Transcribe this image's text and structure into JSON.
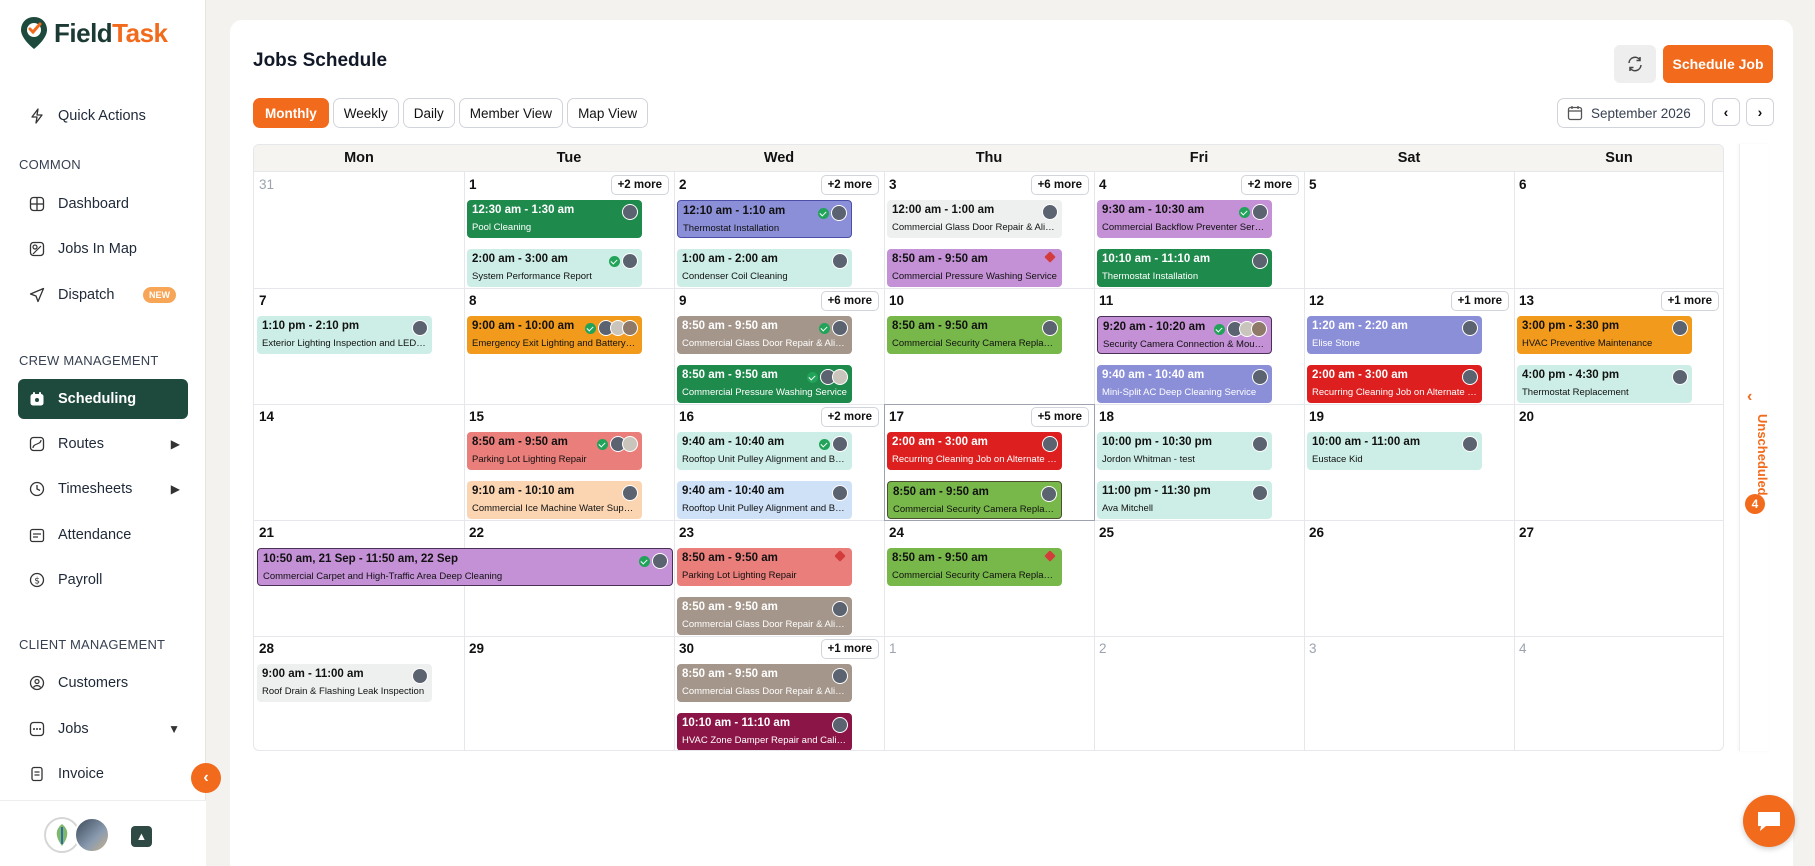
{
  "app": {
    "name_main": "Field",
    "name_accent": "Task"
  },
  "sidebar": {
    "quick_actions": "Quick Actions",
    "common_label": "COMMON",
    "common": [
      {
        "label": "Dashboard",
        "icon": "grid-icon"
      },
      {
        "label": "Jobs In Map",
        "icon": "map-icon"
      },
      {
        "label": "Dispatch",
        "icon": "send-icon",
        "badge": "NEW"
      }
    ],
    "crew_label": "CREW MANAGEMENT",
    "crew": [
      {
        "label": "Scheduling",
        "icon": "calendar-icon",
        "active": true
      },
      {
        "label": "Routes",
        "icon": "route-icon"
      },
      {
        "label": "Timesheets",
        "icon": "clock-icon"
      },
      {
        "label": "Attendance",
        "icon": "attendance-icon"
      },
      {
        "label": "Payroll",
        "icon": "payroll-icon"
      }
    ],
    "client_label": "CLIENT MANAGEMENT",
    "client": [
      {
        "label": "Customers",
        "icon": "customers-icon"
      },
      {
        "label": "Jobs",
        "icon": "jobs-icon"
      },
      {
        "label": "Invoice",
        "icon": "invoice-icon"
      }
    ]
  },
  "header": {
    "title": "Jobs Schedule",
    "schedule_button": "Schedule Job",
    "month": "September 2026"
  },
  "views": [
    "Monthly",
    "Weekly",
    "Daily",
    "Member View",
    "Map View"
  ],
  "active_view": "Monthly",
  "days": [
    "Mon",
    "Tue",
    "Wed",
    "Thu",
    "Fri",
    "Sat",
    "Sun"
  ],
  "weeks": [
    [
      {
        "num": "31",
        "muted": true
      },
      {
        "num": "1",
        "more": "+2 more",
        "events": [
          {
            "time": "12:30 am - 1:30 am",
            "title": "Pool Cleaning",
            "color": "green",
            "check": false,
            "avatars": 1
          },
          {
            "time": "2:00 am - 3:00 am",
            "title": "System Performance Report",
            "color": "mint",
            "check": true,
            "avatars": 1
          }
        ]
      },
      {
        "num": "2",
        "more": "+2 more",
        "events": [
          {
            "time": "12:10 am - 1:10 am",
            "title": "Thermostat Installation",
            "color": "blue",
            "check": true,
            "avatars": 1
          },
          {
            "time": "1:00 am - 2:00 am",
            "title": "Condenser Coil Cleaning",
            "color": "mint",
            "check": false,
            "avatars": 1
          }
        ]
      },
      {
        "num": "3",
        "more": "+6 more",
        "events": [
          {
            "time": "12:00 am - 1:00 am",
            "title": "Commercial Glass Door Repair & Alignment",
            "color": "gray",
            "check": false,
            "avatars": 1
          },
          {
            "time": "8:50 am - 9:50 am",
            "title": "Commercial Pressure Washing Service",
            "color": "purple",
            "check": false,
            "pin": true,
            "avatars": 0
          }
        ]
      },
      {
        "num": "4",
        "more": "+2 more",
        "events": [
          {
            "time": "9:30 am - 10:30 am",
            "title": "Commercial Backflow Preventer Service",
            "color": "purple",
            "check": true,
            "avatars": 1
          },
          {
            "time": "10:10 am - 11:10 am",
            "title": "Thermostat Installation",
            "color": "green",
            "check": false,
            "avatars": 1
          }
        ]
      },
      {
        "num": "5"
      },
      {
        "num": "6"
      }
    ],
    [
      {
        "num": "7",
        "events": [
          {
            "time": "1:10 pm - 2:10 pm",
            "title": "Exterior Lighting Inspection and LED Fixture Upgrade",
            "color": "mint",
            "check": false,
            "avatars": 1
          }
        ]
      },
      {
        "num": "8",
        "events": [
          {
            "time": "9:00 am - 10:00 am",
            "title": "Emergency Exit Lighting and Battery Backup Test",
            "color": "orange",
            "check": true,
            "avatars": 3
          }
        ]
      },
      {
        "num": "9",
        "more": "+6 more",
        "events": [
          {
            "time": "8:50 am - 9:50 am",
            "title": "Commercial Glass Door Repair & Alignment",
            "color": "taupe",
            "check": true,
            "avatars": 1
          },
          {
            "time": "8:50 am - 9:50 am",
            "title": "Commercial Pressure Washing Service",
            "color": "green",
            "check": true,
            "avatars": 2
          }
        ]
      },
      {
        "num": "10",
        "events": [
          {
            "time": "8:50 am - 9:50 am",
            "title": "Commercial Security Camera Replacement",
            "color": "lgreen",
            "check": false,
            "avatars": 1
          }
        ]
      },
      {
        "num": "11",
        "events": [
          {
            "time": "9:20 am - 10:20 am",
            "title": "Security Camera Connection & Mounting Fix",
            "color": "purple-b",
            "check": true,
            "avatars": 3
          },
          {
            "time": "9:40 am - 10:40 am",
            "title": "Mini-Split AC Deep Cleaning Service",
            "color": "periw",
            "check": false,
            "avatars": 1
          }
        ]
      },
      {
        "num": "12",
        "more": "+1 more",
        "events": [
          {
            "time": "1:20 am - 2:20 am",
            "title": "Elise Stone",
            "color": "periw",
            "check": false,
            "avatars": 1
          },
          {
            "time": "2:00 am - 3:00 am",
            "title": "Recurring Cleaning Job on Alternate Fridays",
            "color": "red",
            "check": false,
            "avatars": 1
          }
        ]
      },
      {
        "num": "13",
        "more": "+1 more",
        "events": [
          {
            "time": "3:00 pm - 3:30 pm",
            "title": "HVAC Preventive Maintenance",
            "color": "orange",
            "check": false,
            "avatars": 1
          },
          {
            "time": "4:00 pm - 4:30 pm",
            "title": "Thermostat Replacement",
            "color": "mint",
            "check": false,
            "avatars": 1
          }
        ]
      }
    ],
    [
      {
        "num": "14"
      },
      {
        "num": "15",
        "events": [
          {
            "time": "8:50 am - 9:50 am",
            "title": "Parking Lot Lighting Repair",
            "color": "salmon",
            "check": true,
            "avatars": 2
          },
          {
            "time": "9:10 am - 10:10 am",
            "title": "Commercial Ice Machine Water Supply & Drain",
            "color": "peach",
            "check": false,
            "avatars": 1
          }
        ]
      },
      {
        "num": "16",
        "more": "+2 more",
        "events": [
          {
            "time": "9:40 am - 10:40 am",
            "title": "Rooftop Unit Pulley Alignment and Belt Service",
            "color": "mint",
            "check": true,
            "avatars": 1
          },
          {
            "time": "9:40 am - 10:40 am",
            "title": "Rooftop Unit Pulley Alignment and Belt Service",
            "color": "lblue",
            "check": false,
            "avatars": 1
          }
        ]
      },
      {
        "num": "17",
        "more": "+5 more",
        "today": true,
        "events": [
          {
            "time": "2:00 am - 3:00 am",
            "title": "Recurring Cleaning Job on Alternate Fridays",
            "color": "red",
            "check": false,
            "avatars": 1
          },
          {
            "time": "8:50 am - 9:50 am",
            "title": "Commercial Security Camera Replacement",
            "color": "lgreen-b",
            "check": false,
            "avatars": 1
          }
        ]
      },
      {
        "num": "18",
        "events": [
          {
            "time": "10:00 pm - 10:30 pm",
            "title": "Jordon Whitman - test",
            "color": "mint",
            "check": false,
            "avatars": 1
          },
          {
            "time": "11:00 pm - 11:30 pm",
            "title": "Ava Mitchell",
            "color": "mint",
            "check": false,
            "avatars": 1
          }
        ]
      },
      {
        "num": "19",
        "events": [
          {
            "time": "10:00 am - 11:00 am",
            "title": "Eustace Kid",
            "color": "mint",
            "check": false,
            "avatars": 1
          }
        ]
      },
      {
        "num": "20"
      }
    ],
    [
      {
        "num": "21"
      },
      {
        "num": "22"
      },
      {
        "num": "23",
        "events": [
          {
            "time": "8:50 am - 9:50 am",
            "title": "Parking Lot Lighting Repair",
            "color": "salmon",
            "check": false,
            "pin": true,
            "avatars": 0
          },
          {
            "time": "8:50 am - 9:50 am",
            "title": "Commercial Glass Door Repair & Alignment",
            "color": "taupe",
            "check": false,
            "avatars": 1
          }
        ]
      },
      {
        "num": "24",
        "events": [
          {
            "time": "8:50 am - 9:50 am",
            "title": "Commercial Security Camera Replacement",
            "color": "lgreen",
            "check": false,
            "pin": true,
            "avatars": 0
          }
        ]
      },
      {
        "num": "25"
      },
      {
        "num": "26"
      },
      {
        "num": "27"
      }
    ],
    [
      {
        "num": "28",
        "events": [
          {
            "time": "9:00 am - 11:00 am",
            "title": "Roof Drain & Flashing Leak Inspection",
            "color": "gray",
            "check": false,
            "avatars": 1
          }
        ]
      },
      {
        "num": "29"
      },
      {
        "num": "30",
        "more": "+1 more",
        "events": [
          {
            "time": "8:50 am - 9:50 am",
            "title": "Commercial Glass Door Repair & Alignment",
            "color": "taupe",
            "check": false,
            "avatars": 1
          },
          {
            "time": "10:10 am - 11:10 am",
            "title": "HVAC Zone Damper Repair and Calibration",
            "color": "wine",
            "check": false,
            "avatars": 1
          }
        ]
      },
      {
        "num": "1",
        "muted": true
      },
      {
        "num": "2",
        "muted": true
      },
      {
        "num": "3",
        "muted": true
      },
      {
        "num": "4",
        "muted": true
      }
    ]
  ],
  "spanning_event": {
    "time": "10:50 am, 21 Sep - 11:50 am, 22 Sep",
    "title": "Commercial Carpet and High-Traffic Area Deep Cleaning",
    "color": "purple-b",
    "check": true,
    "avatars": 1
  },
  "unscheduled": {
    "label": "Unscheduled",
    "count": "4"
  },
  "colors": {
    "accent": "#f26a1b",
    "sidebar_active": "#1e4a3e"
  }
}
